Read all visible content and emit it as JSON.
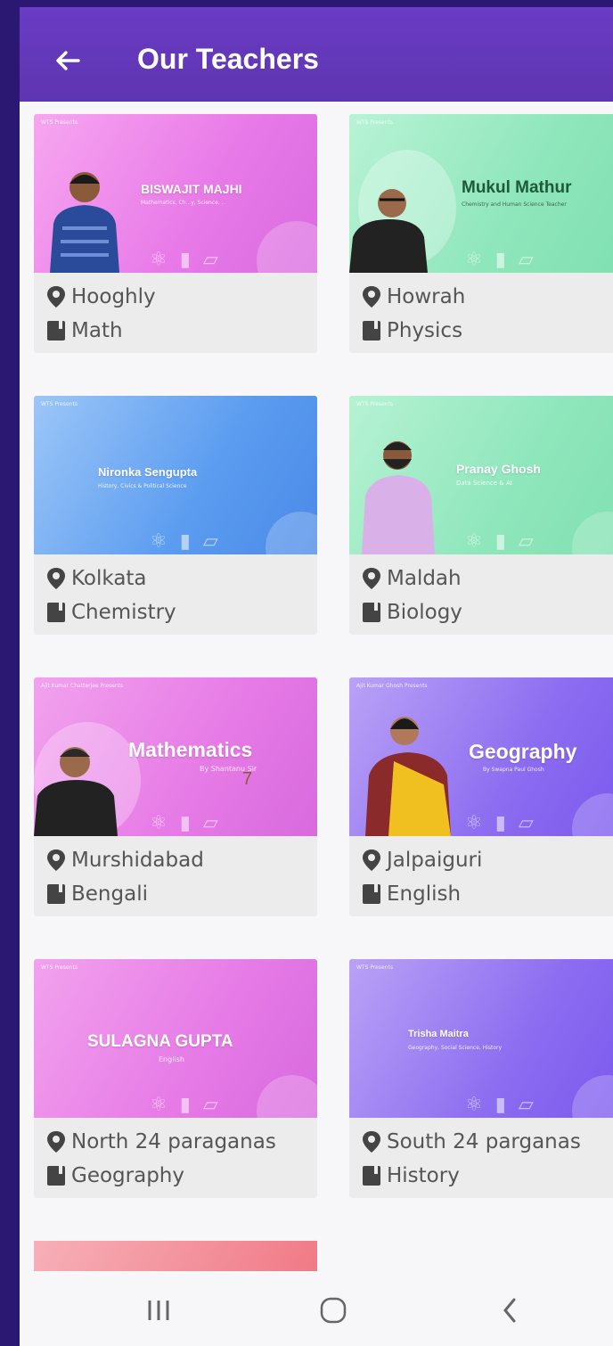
{
  "header": {
    "title": "Our Teachers"
  },
  "cards": [
    {
      "location": "Hooghly",
      "subject": "Math",
      "banner_name": "BISWAJIT MAJHI",
      "banner_sub": "Mathematics, Ch...y, Science, ...",
      "banner_tag": "WTS Presents"
    },
    {
      "location": "Howrah",
      "subject": "Physics",
      "banner_name": "Mukul Mathur",
      "banner_sub": "Chemistry and Human Science Teacher",
      "banner_tag": "WTS Presents"
    },
    {
      "location": "Kolkata",
      "subject": "Chemistry",
      "banner_name": "Nironka Sengupta",
      "banner_sub": "History, Civics & Political Science",
      "banner_tag": "WTS Presents"
    },
    {
      "location": "Maldah",
      "subject": "Biology",
      "banner_name": "Pranay Ghosh",
      "banner_sub": "Data Science & AI",
      "banner_tag": "WTS Presents"
    },
    {
      "location": "Murshidabad",
      "subject": "Bengali",
      "banner_name": "Mathematics",
      "banner_sub": "By Shantanu Sir",
      "banner_tag": "Ajit Kumar Chatterjee Presents"
    },
    {
      "location": "Jalpaiguri",
      "subject": "English",
      "banner_name": "Geography",
      "banner_sub": "By Swapna Paul Ghosh",
      "banner_tag": "Ajit Kumar Ghosh Presents"
    },
    {
      "location": "North 24 paraganas",
      "subject": "Geography",
      "banner_name": "SULAGNA GUPTA",
      "banner_sub": "English",
      "banner_tag": "WTS Presents"
    },
    {
      "location": "South 24 parganas",
      "subject": "History",
      "banner_name": "Trisha Maitra",
      "banner_sub": "Geography, Social Science, History",
      "banner_tag": "WTS Presents"
    }
  ],
  "overlay_number": "7",
  "colors": {
    "appbar": "#5e35b1",
    "frame": "#2a1873",
    "card_bg": "#ececec"
  }
}
